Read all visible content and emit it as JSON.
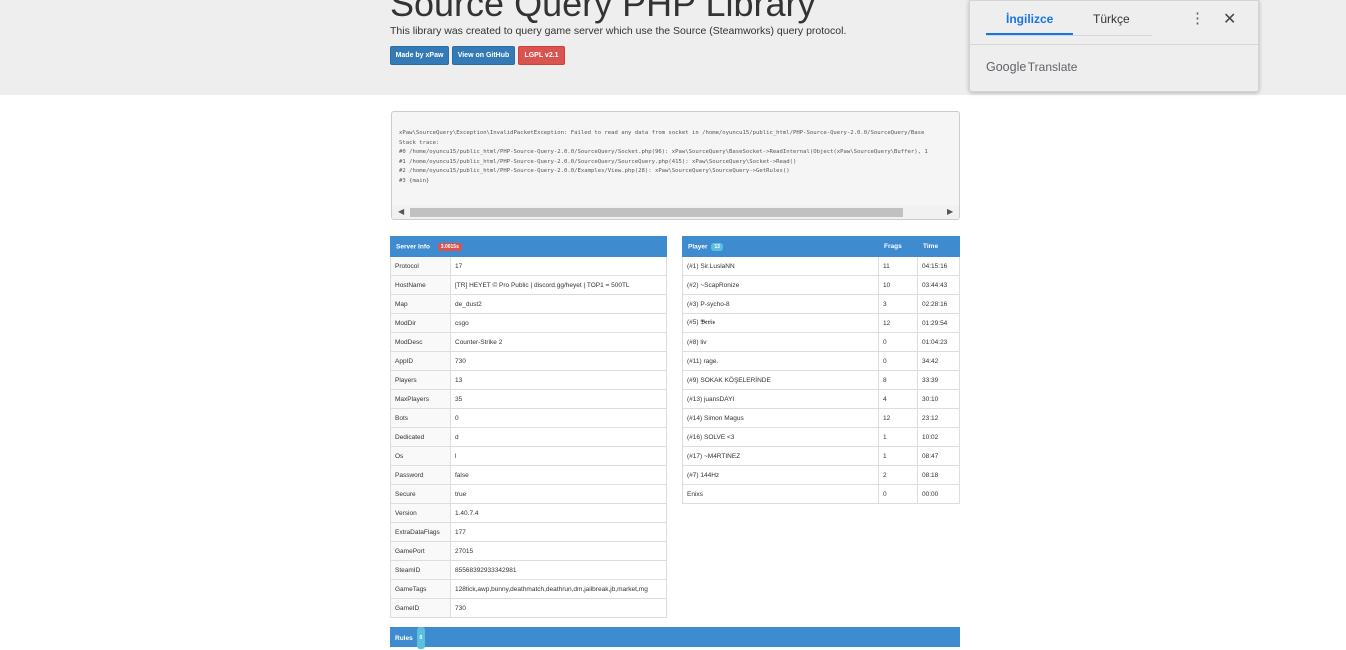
{
  "header": {
    "title": "Source Query PHP Library",
    "subtitle": "This library was created to query game server which use the Source (Steamworks) query protocol.",
    "buttons": {
      "made_by": "Made by xPaw",
      "github": "View on GitHub",
      "license": "LGPL v2.1"
    }
  },
  "error": {
    "text": "xPaw\\SourceQuery\\Exception\\InvalidPacketException: Failed to read any data from socket in /home/oyuncu15/public_html/PHP-Source-Query-2.0.0/SourceQuery/Base\nStack trace:\n#0 /home/oyuncu15/public_html/PHP-Source-Query-2.0.0/SourceQuery/Socket.php(96): xPaw\\SourceQuery\\BaseSocket->ReadInternal(Object(xPaw\\SourceQuery\\Buffer), 1\n#1 /home/oyuncu15/public_html/PHP-Source-Query-2.0.0/SourceQuery/SourceQuery.php(415): xPaw\\SourceQuery\\Socket->Read()\n#2 /home/oyuncu15/public_html/PHP-Source-Query-2.0.0/Examples/View.php(28): xPaw\\SourceQuery\\SourceQuery->GetRules()\n#3 {main}"
  },
  "server_info": {
    "header": "Server Info",
    "timer_badge": "3.0015s",
    "rows": [
      {
        "key": "Protocol",
        "value": "17"
      },
      {
        "key": "HostName",
        "value": "[TR] HEYET © Pro Public | discord.gg/heyet | TOP1 = 500TL"
      },
      {
        "key": "Map",
        "value": "de_dust2"
      },
      {
        "key": "ModDir",
        "value": "csgo"
      },
      {
        "key": "ModDesc",
        "value": "Counter-Strike 2"
      },
      {
        "key": "AppID",
        "value": "730"
      },
      {
        "key": "Players",
        "value": "13"
      },
      {
        "key": "MaxPlayers",
        "value": "35"
      },
      {
        "key": "Bots",
        "value": "0"
      },
      {
        "key": "Dedicated",
        "value": "d"
      },
      {
        "key": "Os",
        "value": "l"
      },
      {
        "key": "Password",
        "value": "false"
      },
      {
        "key": "Secure",
        "value": "true"
      },
      {
        "key": "Version",
        "value": "1.40.7.4"
      },
      {
        "key": "ExtraDataFlags",
        "value": "177"
      },
      {
        "key": "GamePort",
        "value": "27015"
      },
      {
        "key": "SteamID",
        "value": "85568392933342981"
      },
      {
        "key": "GameTags",
        "value": "128tick,awp,bunny,deathmatch,deathrun,dm,jailbreak,jb,market,mg"
      },
      {
        "key": "GameID",
        "value": "730"
      }
    ]
  },
  "players": {
    "header": "Player",
    "count": "13",
    "frags_header": "Frags",
    "time_header": "Time",
    "rows": [
      {
        "name": "(#1) Sir.LuslaNN",
        "frags": "11",
        "time": "04:15:16"
      },
      {
        "name": "(#2) ~ScapRonize",
        "frags": "10",
        "time": "03:44:43"
      },
      {
        "name": "(#3) P-sycho-8",
        "frags": "3",
        "time": "02:28:16"
      },
      {
        "name": "(#5) 𝕭𝖊𝖗𝖎𝖘",
        "frags": "12",
        "time": "01:29:54"
      },
      {
        "name": "(#8) liv",
        "frags": "0",
        "time": "01:04:23"
      },
      {
        "name": "(#11) rage.",
        "frags": "0",
        "time": "34:42"
      },
      {
        "name": "(#9) SOKAK KÖŞELERİNDE",
        "frags": "8",
        "time": "33:39"
      },
      {
        "name": "(#13) juansDAYI",
        "frags": "4",
        "time": "30:10"
      },
      {
        "name": "(#14) Simon Magus",
        "frags": "12",
        "time": "23:12"
      },
      {
        "name": "(#16) SOLVE <3",
        "frags": "1",
        "time": "10:02"
      },
      {
        "name": "(#17) ~M4RTINEZ",
        "frags": "1",
        "time": "08:47"
      },
      {
        "name": "(#7) 144Hz",
        "frags": "2",
        "time": "08:18"
      },
      {
        "name": "Enixs",
        "frags": "0",
        "time": "00:00"
      }
    ]
  },
  "rules": {
    "header": "Rules",
    "count": "0"
  },
  "translate_popup": {
    "tab_source": "İngilizce",
    "tab_target": "Türkçe",
    "brand_google": "Google",
    "brand_translate": "Translate"
  },
  "colors": {
    "table_header": "#3e8bd0",
    "primary": "#337ab7",
    "danger": "#d9534f",
    "translate_accent": "#1a73e8"
  }
}
